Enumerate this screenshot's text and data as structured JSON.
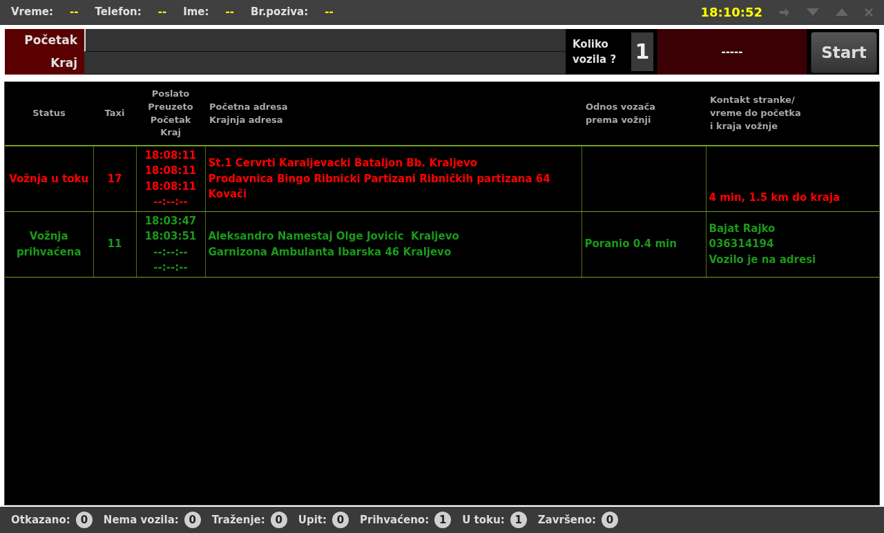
{
  "call_info": [
    {
      "label": "Vreme:",
      "value": "--"
    },
    {
      "label": "Telefon:",
      "value": "--"
    },
    {
      "label": "Ime:",
      "value": "--"
    },
    {
      "label": "Br.poziva:",
      "value": "--"
    }
  ],
  "clock": "18:10:52",
  "order_form": {
    "start_label": "Početak",
    "end_label": "Kraj",
    "vehicles_label": [
      "Koliko",
      "vozila ?"
    ],
    "vehicles_count": "1",
    "result": "-----",
    "start_button": "Start"
  },
  "table": {
    "columns": [
      [
        "Status"
      ],
      [
        "Taxi"
      ],
      [
        "Poslato",
        "Preuzeto",
        "Početak",
        "Kraj"
      ],
      [
        "Početna adresa",
        "Krajnja adresa"
      ],
      [
        "Odnos vozača",
        "prema vožnji"
      ],
      [
        "Kontakt stranke/",
        "vreme do početka",
        "i kraja vožnje"
      ]
    ],
    "rows": [
      {
        "color": "#ff0000",
        "status": [
          "Vožnja u toku"
        ],
        "taxi": "17",
        "times": [
          "18:08:11",
          "18:08:11",
          "18:08:11",
          "--:--:--"
        ],
        "address": [
          "St.1 Cervrti Karaljevacki Bataljon Bb. Kraljevo",
          "Prodavnica Bingo Ribnicki Partizani Ribničkih partizana 64",
          "Kovači"
        ],
        "driver_relation": [],
        "contact": [
          "4 min, 1.5 km do kraja"
        ]
      },
      {
        "color": "#1a9a1a",
        "status": [
          "Vožnja",
          "prihvaćena"
        ],
        "taxi": "11",
        "times": [
          "18:03:47",
          "18:03:51",
          "--:--:--",
          "--:--:--"
        ],
        "address": [
          "Aleksandro Namestaj Olge Jovicic  Kraljevo",
          "Garnizona Ambulanta Ibarska 46 Kraljevo"
        ],
        "driver_relation": [
          "Poranio 0.4 min"
        ],
        "contact": [
          "Bajat Rajko",
          "036314194",
          "Vozilo je na adresi"
        ]
      }
    ]
  },
  "status_bar": [
    {
      "label": "Otkazano:",
      "count": "0"
    },
    {
      "label": "Nema vozila:",
      "count": "0"
    },
    {
      "label": "Traženje:",
      "count": "0"
    },
    {
      "label": "Upit:",
      "count": "0"
    },
    {
      "label": "Prihvaćeno:",
      "count": "1"
    },
    {
      "label": "U toku:",
      "count": "1"
    },
    {
      "label": "Završeno:",
      "count": "0"
    }
  ]
}
